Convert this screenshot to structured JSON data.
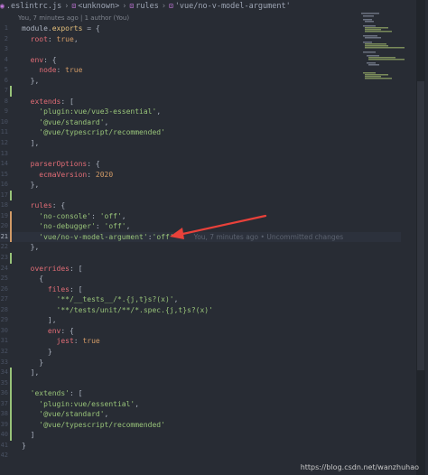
{
  "breadcrumb": {
    "items": [
      ".eslintrc.js",
      "<unknown>",
      "rules",
      "'vue/no-v-model-argument'"
    ]
  },
  "blame_header": "You, 7 minutes ago | 1 author (You)",
  "inline_blame": "You, 7 minutes ago • Uncommitted changes",
  "colors": {
    "background": "#282c34",
    "added_line": "#98c379",
    "modified_line": "#d19a66",
    "arrow": "#e8413a"
  },
  "lines": [
    {
      "n": "1",
      "mark": "",
      "tokens": [
        [
          "c-punc",
          "module."
        ],
        [
          "c-prop",
          "exports"
        ],
        [
          "c-punc",
          " = {"
        ]
      ]
    },
    {
      "n": "2",
      "mark": "",
      "tokens": [
        [
          "c-key",
          "  root"
        ],
        [
          "c-punc",
          ": "
        ],
        [
          "c-bool",
          "true"
        ],
        [
          "c-punc",
          ","
        ]
      ]
    },
    {
      "n": "3",
      "mark": "",
      "tokens": []
    },
    {
      "n": "4",
      "mark": "",
      "tokens": [
        [
          "c-key",
          "  env"
        ],
        [
          "c-punc",
          ": {"
        ]
      ]
    },
    {
      "n": "5",
      "mark": "",
      "tokens": [
        [
          "c-key",
          "    node"
        ],
        [
          "c-punc",
          ": "
        ],
        [
          "c-bool",
          "true"
        ]
      ]
    },
    {
      "n": "6",
      "mark": "",
      "tokens": [
        [
          "c-punc",
          "  },"
        ]
      ]
    },
    {
      "n": "7",
      "mark": "add",
      "tokens": []
    },
    {
      "n": "8",
      "mark": "",
      "tokens": [
        [
          "c-key",
          "  extends"
        ],
        [
          "c-punc",
          ": ["
        ]
      ]
    },
    {
      "n": "9",
      "mark": "",
      "tokens": [
        [
          "c-str",
          "    'plugin:vue/vue3-essential'"
        ],
        [
          "c-punc",
          ","
        ]
      ]
    },
    {
      "n": "10",
      "mark": "",
      "tokens": [
        [
          "c-str",
          "    '@vue/standard'"
        ],
        [
          "c-punc",
          ","
        ]
      ]
    },
    {
      "n": "11",
      "mark": "",
      "tokens": [
        [
          "c-str",
          "    '@vue/typescript/recommended'"
        ]
      ]
    },
    {
      "n": "12",
      "mark": "",
      "tokens": [
        [
          "c-punc",
          "  ],"
        ]
      ]
    },
    {
      "n": "13",
      "mark": "",
      "tokens": []
    },
    {
      "n": "14",
      "mark": "",
      "tokens": [
        [
          "c-key",
          "  parserOptions"
        ],
        [
          "c-punc",
          ": {"
        ]
      ]
    },
    {
      "n": "15",
      "mark": "",
      "tokens": [
        [
          "c-key",
          "    ecmaVersion"
        ],
        [
          "c-punc",
          ": "
        ],
        [
          "c-num",
          "2020"
        ]
      ]
    },
    {
      "n": "16",
      "mark": "",
      "tokens": [
        [
          "c-punc",
          "  },"
        ]
      ]
    },
    {
      "n": "17",
      "mark": "add",
      "tokens": []
    },
    {
      "n": "18",
      "mark": "",
      "tokens": [
        [
          "c-key",
          "  rules"
        ],
        [
          "c-punc",
          ": {"
        ]
      ]
    },
    {
      "n": "19",
      "mark": "mod",
      "tokens": [
        [
          "c-str",
          "    'no-console'"
        ],
        [
          "c-punc",
          ": "
        ],
        [
          "c-str",
          "'off'"
        ],
        [
          "c-punc",
          ","
        ]
      ]
    },
    {
      "n": "20",
      "mark": "mod",
      "tokens": [
        [
          "c-str",
          "    'no-debugger'"
        ],
        [
          "c-punc",
          ": "
        ],
        [
          "c-str",
          "'off'"
        ],
        [
          "c-punc",
          ","
        ]
      ]
    },
    {
      "n": "21",
      "mark": "mod",
      "current": true,
      "blame": true,
      "tokens": [
        [
          "c-str",
          "    'vue/no-v-model-argument'"
        ],
        [
          "c-punc",
          ":"
        ],
        [
          "c-str",
          "'off'"
        ]
      ]
    },
    {
      "n": "22",
      "mark": "",
      "tokens": [
        [
          "c-punc",
          "  },"
        ]
      ]
    },
    {
      "n": "23",
      "mark": "add",
      "tokens": []
    },
    {
      "n": "24",
      "mark": "",
      "tokens": [
        [
          "c-key",
          "  overrides"
        ],
        [
          "c-punc",
          ": ["
        ]
      ]
    },
    {
      "n": "25",
      "mark": "",
      "tokens": [
        [
          "c-punc",
          "    {"
        ]
      ]
    },
    {
      "n": "26",
      "mark": "",
      "tokens": [
        [
          "c-key",
          "      files"
        ],
        [
          "c-punc",
          ": ["
        ]
      ]
    },
    {
      "n": "27",
      "mark": "",
      "tokens": [
        [
          "c-str",
          "        '**/__tests__/*.{j,t}s?(x)'"
        ],
        [
          "c-punc",
          ","
        ]
      ]
    },
    {
      "n": "28",
      "mark": "",
      "tokens": [
        [
          "c-str",
          "        '**/tests/unit/**/*.spec.{j,t}s?(x)'"
        ]
      ]
    },
    {
      "n": "29",
      "mark": "",
      "tokens": [
        [
          "c-punc",
          "      ],"
        ]
      ]
    },
    {
      "n": "30",
      "mark": "",
      "tokens": [
        [
          "c-key",
          "      env"
        ],
        [
          "c-punc",
          ": {"
        ]
      ]
    },
    {
      "n": "31",
      "mark": "",
      "tokens": [
        [
          "c-key",
          "        jest"
        ],
        [
          "c-punc",
          ": "
        ],
        [
          "c-bool",
          "true"
        ]
      ]
    },
    {
      "n": "32",
      "mark": "",
      "tokens": [
        [
          "c-punc",
          "      }"
        ]
      ]
    },
    {
      "n": "33",
      "mark": "",
      "tokens": [
        [
          "c-punc",
          "    }"
        ]
      ]
    },
    {
      "n": "34",
      "mark": "add",
      "tokens": [
        [
          "c-punc",
          "  ],"
        ]
      ]
    },
    {
      "n": "35",
      "mark": "add",
      "tokens": []
    },
    {
      "n": "36",
      "mark": "add",
      "tokens": [
        [
          "c-str",
          "  'extends'"
        ],
        [
          "c-punc",
          ": ["
        ]
      ]
    },
    {
      "n": "37",
      "mark": "add",
      "tokens": [
        [
          "c-str",
          "    'plugin:vue/essential'"
        ],
        [
          "c-punc",
          ","
        ]
      ]
    },
    {
      "n": "38",
      "mark": "add",
      "tokens": [
        [
          "c-str",
          "    '@vue/standard'"
        ],
        [
          "c-punc",
          ","
        ]
      ]
    },
    {
      "n": "39",
      "mark": "add",
      "tokens": [
        [
          "c-str",
          "    '@vue/typescript/recommended'"
        ]
      ]
    },
    {
      "n": "40",
      "mark": "add",
      "tokens": [
        [
          "c-punc",
          "  ]"
        ]
      ]
    },
    {
      "n": "41",
      "mark": "",
      "tokens": [
        [
          "c-punc",
          "}"
        ]
      ]
    },
    {
      "n": "42",
      "mark": "",
      "tokens": []
    }
  ],
  "watermark": "https://blog.csdn.net/wanzhuhao"
}
